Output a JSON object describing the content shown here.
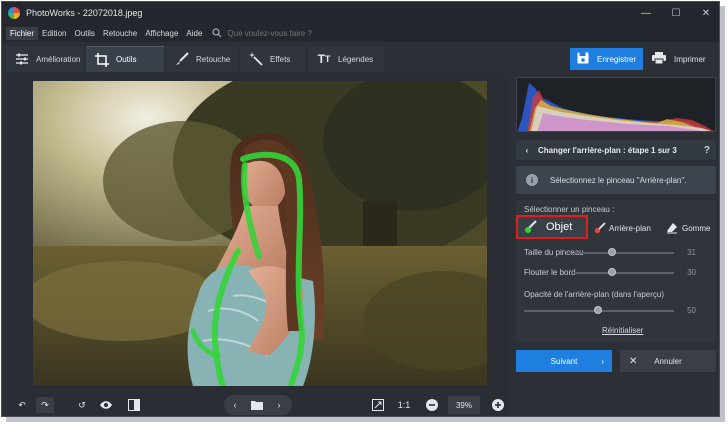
{
  "app": {
    "title": "PhotoWorks - 22072018.jpeg",
    "window_controls": [
      "minimize-icon",
      "maximize-icon",
      "close-icon"
    ]
  },
  "menu": {
    "items": [
      "Fichier",
      "Edition",
      "Outils",
      "Retouche",
      "Affichage",
      "Aide"
    ],
    "active": "Fichier",
    "search_placeholder": "Que voulez-vous faire ?"
  },
  "tabs": [
    {
      "label": "Amélioration",
      "icon": "sliders-icon",
      "active": false
    },
    {
      "label": "Outils",
      "icon": "crop-icon",
      "active": true
    },
    {
      "label": "Retouche",
      "icon": "brush-icon",
      "active": false
    },
    {
      "label": "Effets",
      "icon": "magic-wand-icon",
      "active": false
    },
    {
      "label": "Légendes",
      "icon": "text-icon",
      "active": false
    }
  ],
  "toolbar": {
    "save_label": "Enregistrer",
    "print_label": "Imprimer"
  },
  "panel": {
    "step_title": "Changer l'arrière-plan : étape 1 sur 3",
    "help": "?",
    "info_text": "Sélectionnez le pinceau \"Arrière-plan\".",
    "brush_label": "Sélectionner un pinceau :",
    "brushes": [
      {
        "label": "Objet",
        "selected": true
      },
      {
        "label": "Arrière-plan",
        "selected": false
      },
      {
        "label": "Gomme",
        "selected": false
      }
    ],
    "sliders": [
      {
        "label": "Taille du pinceau",
        "value": 31,
        "fraction": 0.31
      },
      {
        "label": "Flouter le bord",
        "value": 30,
        "fraction": 0.3
      },
      {
        "label": "Opacité de l'arrière-plan (dans l'aperçu)",
        "value": 50,
        "fraction": 0.5
      }
    ],
    "reset_label": "Réinitialiser",
    "next_label": "Suivant",
    "cancel_label": "Annuler"
  },
  "bottombar": {
    "ratio_label": "1:1",
    "zoom": "39%"
  },
  "colors": {
    "accent": "#1f7fe0",
    "selection_outline": "#e01e1e",
    "brush_object_stroke": "#35d43a"
  }
}
